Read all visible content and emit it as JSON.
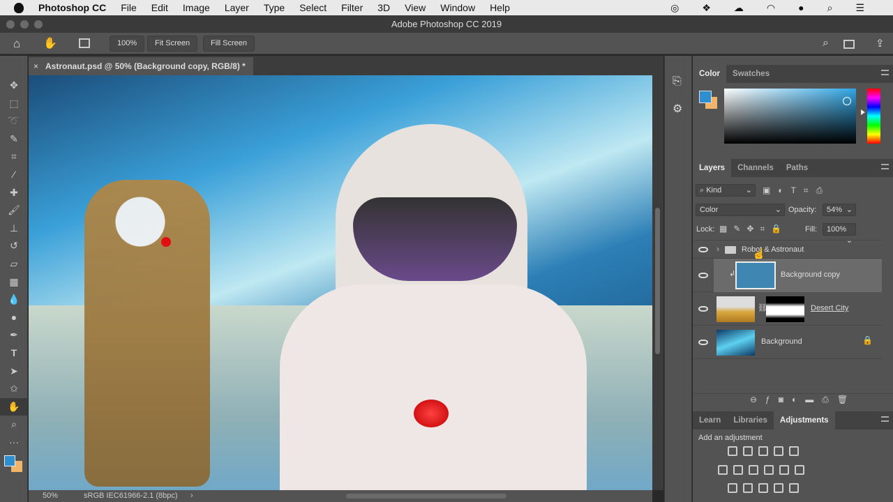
{
  "menubar": {
    "apple": "",
    "app": "Photoshop CC",
    "items": [
      "File",
      "Edit",
      "Image",
      "Layer",
      "Type",
      "Select",
      "Filter",
      "3D",
      "View",
      "Window",
      "Help"
    ]
  },
  "window": {
    "title": "Adobe Photoshop CC 2019"
  },
  "options": {
    "zoom": "100%",
    "fit_screen": "Fit Screen",
    "fill_screen": "Fill Screen"
  },
  "document": {
    "tab_title": "Astronaut.psd @ 50% (Background copy, RGB/8) *",
    "close": "×"
  },
  "status": {
    "zoom": "50%",
    "profile": "sRGB IEC61966-2.1 (8bpc)",
    "arrow": "›"
  },
  "color_panel": {
    "tabs": [
      "Color",
      "Swatches"
    ],
    "foreground": "#2d8fd0",
    "background": "#f0b46a"
  },
  "layers_panel": {
    "tabs": [
      "Layers",
      "Channels",
      "Paths"
    ],
    "filter_kind": "Kind",
    "blend_mode": "Color",
    "opacity_label": "Opacity:",
    "opacity": "54%",
    "lock_label": "Lock:",
    "fill_label": "Fill:",
    "fill": "100%",
    "layers": [
      {
        "name": "Robot & Astronaut",
        "type": "group"
      },
      {
        "name": "Background copy",
        "type": "fill",
        "color": "#3f86b3",
        "selected": true
      },
      {
        "name": "Desert City",
        "type": "masked"
      },
      {
        "name": "Background",
        "type": "locked"
      }
    ]
  },
  "bottom_panel": {
    "tabs": [
      "Learn",
      "Libraries",
      "Adjustments"
    ],
    "hint": "Add an adjustment"
  }
}
